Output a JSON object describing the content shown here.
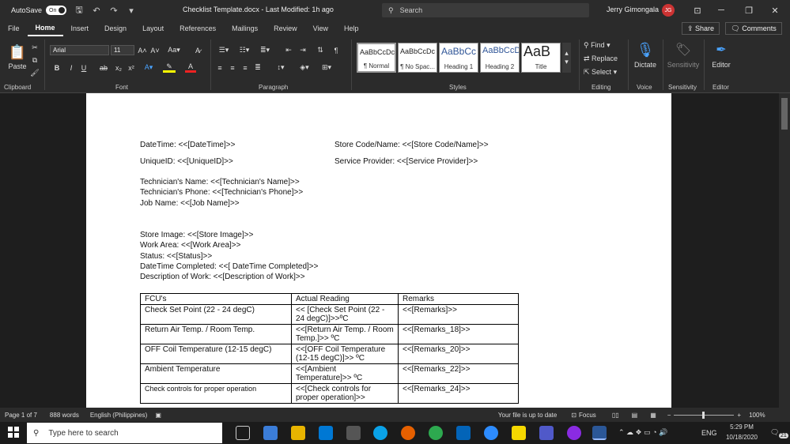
{
  "titlebar": {
    "autosave_label": "AutoSave",
    "autosave_state": "On",
    "doc_title": "Checklist Template.docx - Last Modified: 1h ago",
    "search_placeholder": "Search",
    "user_name": "Jerry Gimongala",
    "user_initials": "JG"
  },
  "menu": {
    "tabs": [
      "File",
      "Home",
      "Insert",
      "Design",
      "Layout",
      "References",
      "Mailings",
      "Review",
      "View",
      "Help"
    ],
    "active": "Home",
    "share_label": "Share",
    "comments_label": "Comments"
  },
  "ribbon": {
    "paste_label": "Paste",
    "font_name": "Arial",
    "font_size": "11",
    "styles": [
      {
        "sample": "AaBbCcDc",
        "name": "¶ Normal"
      },
      {
        "sample": "AaBbCcDc",
        "name": "¶ No Spac..."
      },
      {
        "sample": "AaBbCc",
        "name": "Heading 1"
      },
      {
        "sample": "AaBbCcD",
        "name": "Heading 2"
      },
      {
        "sample": "AaB",
        "name": "Title"
      }
    ],
    "find_label": "Find",
    "replace_label": "Replace",
    "select_label": "Select",
    "dictate_label": "Dictate",
    "sensitivity_label": "Sensitivity",
    "editor_label": "Editor",
    "groups": {
      "clipboard": "Clipboard",
      "font": "Font",
      "paragraph": "Paragraph",
      "styles": "Styles",
      "editing": "Editing",
      "voice": "Voice",
      "sensitivity": "Sensitivity",
      "editor": "Editor"
    }
  },
  "document": {
    "datetime": "DateTime: <<[DateTime]>>",
    "store_code": "Store Code/Name: <<[Store Code/Name]>>",
    "unique_id": "UniqueID: <<[UniqueID]>>",
    "service_provider": "Service Provider: <<[Service Provider]>>",
    "tech_name": "Technician's Name: <<[Technician's Name]>>",
    "tech_phone": "Technician's Phone: <<[Technician's Phone]>>",
    "job_name": "Job Name: <<[Job Name]>>",
    "store_image": "Store Image: <<[Store Image]>>",
    "work_area": "Work Area: <<[Work Area]>>",
    "status": "Status: <<[Status]>>",
    "datetime_completed": "DateTime Completed: <<[ DateTime Completed]>>",
    "description": "Description of Work: <<[Description of Work]>>",
    "table": {
      "headers": [
        "FCU's",
        "Actual Reading",
        "Remarks"
      ],
      "rows": [
        [
          "Check Set Point (22 - 24 degC)",
          "<< [Check Set Point (22 - 24 degC)]>>ºC",
          "<<[Remarks]>>"
        ],
        [
          "Return Air Temp. / Room Temp.",
          "<<[Return Air Temp. / Room Temp.]>> ºC",
          "<<[Remarks_18]>>"
        ],
        [
          "OFF Coil Temperature (12-15 degC)",
          "<<[OFF Coil Temperature (12-15 degC)]>> ºC",
          "<<[Remarks_20]>>"
        ],
        [
          "Ambient Temperature",
          "<<[Ambient Temperature]>> ºC",
          "<<[Remarks_22]>>"
        ],
        [
          "Check controls for proper operation",
          "<<[Check controls for proper operation]>>",
          "<<[Remarks_24]>>"
        ]
      ]
    }
  },
  "status": {
    "page": "Page 1 of 7",
    "words": "888 words",
    "language": "English (Philippines)",
    "save_state": "Your file is up to date",
    "focus": "Focus",
    "zoom": "100%"
  },
  "taskbar": {
    "search_placeholder": "Type here to search",
    "lang": "ENG",
    "time": "5:29 PM",
    "date": "10/18/2020",
    "notifications": "21"
  }
}
